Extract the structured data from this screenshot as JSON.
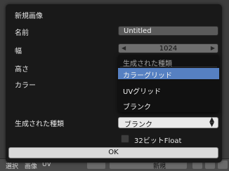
{
  "bottom_bar": {
    "items": [
      "選択",
      "画像",
      "UV",
      "新規"
    ]
  },
  "dialog": {
    "title": "新規画像",
    "name_label": "名前",
    "name_value": "Untitled",
    "width_label": "幅",
    "width_value": "1024",
    "height_label": "高さ",
    "color_label": "カラー",
    "generated_type_label": "生成された種類",
    "generated_type_value": "ブランク",
    "float_label": "32ビットFloat",
    "ok_label": "OK"
  },
  "dropdown": {
    "header": "生成された種類",
    "items": [
      "カラーグリッド",
      "UVグリッド",
      "ブランク"
    ],
    "selected_index": 0
  },
  "colors": {
    "selected_item": "#5680c2",
    "dialog_bg": "#191919"
  }
}
